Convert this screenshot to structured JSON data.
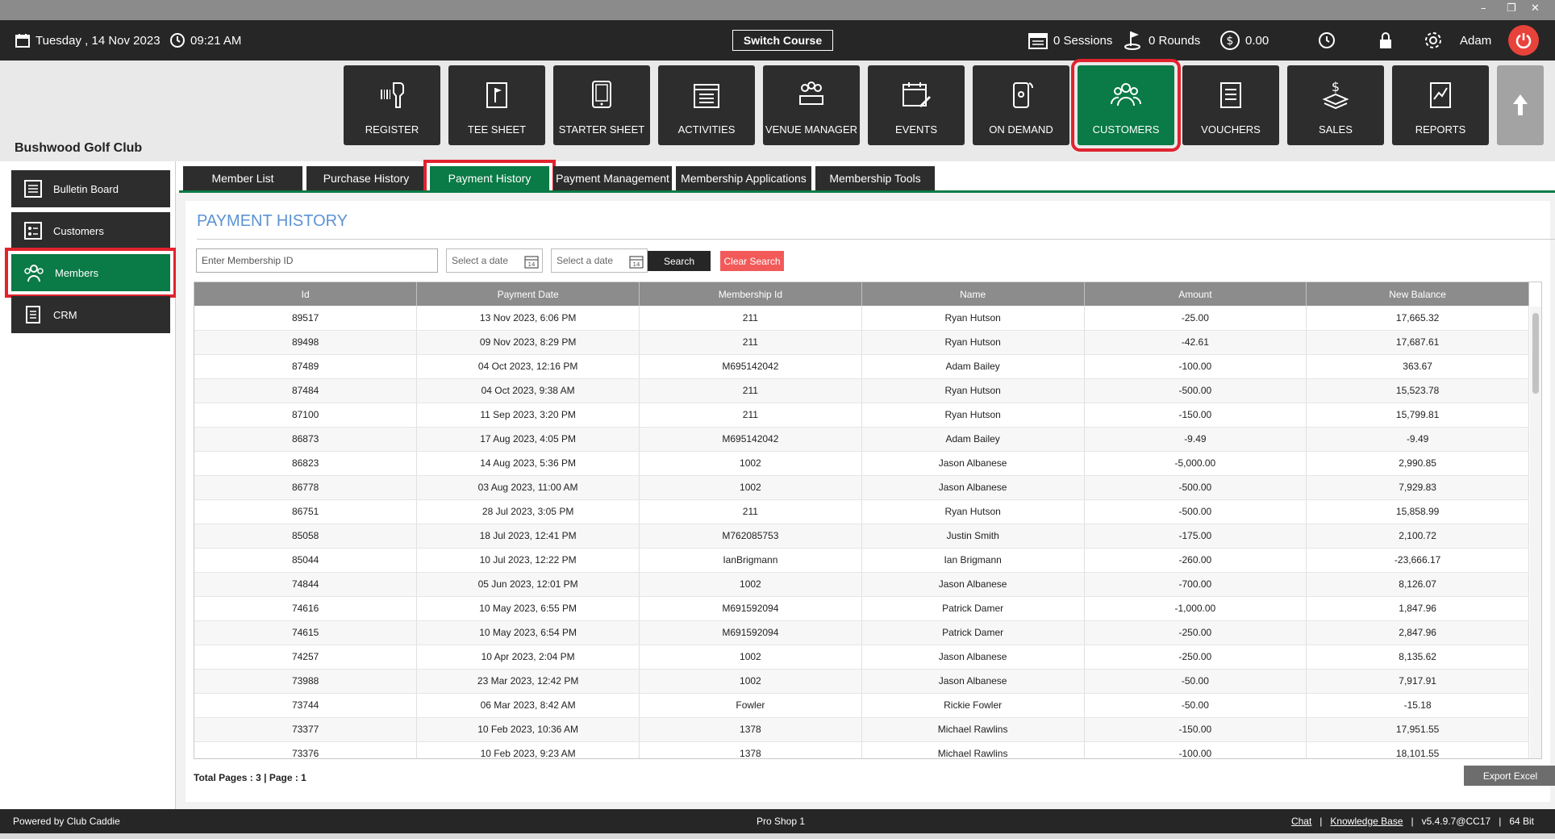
{
  "window": {
    "minimize": "–",
    "restore": "❐",
    "close": "✕"
  },
  "topbar": {
    "date": "Tuesday ,  14 Nov 2023",
    "time": "09:21 AM",
    "switch_course": "Switch Course",
    "sessions": "0 Sessions",
    "rounds": "0 Rounds",
    "balance": "0.00",
    "user": "Adam"
  },
  "club_name": "Bushwood Golf Club",
  "nav": [
    {
      "label": "REGISTER",
      "icon": "barcode-scanner-icon"
    },
    {
      "label": "TEE SHEET",
      "icon": "tee-sheet-icon"
    },
    {
      "label": "STARTER SHEET",
      "icon": "tablet-icon"
    },
    {
      "label": "ACTIVITIES",
      "icon": "activities-calendar-icon"
    },
    {
      "label": "VENUE MANAGER",
      "icon": "venue-manager-icon"
    },
    {
      "label": "EVENTS",
      "icon": "events-calendar-icon"
    },
    {
      "label": "ON DEMAND",
      "icon": "on-demand-phone-icon"
    },
    {
      "label": "CUSTOMERS",
      "icon": "customers-group-icon"
    },
    {
      "label": "VOUCHERS",
      "icon": "vouchers-icon"
    },
    {
      "label": "SALES",
      "icon": "sales-icon"
    },
    {
      "label": "REPORTS",
      "icon": "reports-icon"
    }
  ],
  "sidebar": [
    {
      "label": "Bulletin Board",
      "icon": "bulletin-board-icon"
    },
    {
      "label": "Customers",
      "icon": "customers-list-icon"
    },
    {
      "label": "Members",
      "icon": "members-icon"
    },
    {
      "label": "CRM",
      "icon": "crm-icon"
    }
  ],
  "tabs": [
    "Member List",
    "Purchase History",
    "Payment History",
    "Payment Management",
    "Membership Applications",
    "Membership Tools"
  ],
  "page_title": "PAYMENT HISTORY",
  "search": {
    "membership_placeholder": "Enter Membership ID",
    "date_from": "Select a date",
    "date_to": "Select a date",
    "search_label": "Search",
    "clear_label": "Clear Search"
  },
  "table": {
    "columns": [
      "Id",
      "Payment Date",
      "Membership Id",
      "Name",
      "Amount",
      "New Balance"
    ],
    "rows": [
      [
        "89517",
        "13 Nov 2023, 6:06 PM",
        "211",
        "Ryan  Hutson",
        "-25.00",
        "17,665.32"
      ],
      [
        "89498",
        "09 Nov 2023, 8:29 PM",
        "211",
        "Ryan  Hutson",
        "-42.61",
        "17,687.61"
      ],
      [
        "87489",
        "04 Oct 2023, 12:16 PM",
        "M695142042",
        "Adam  Bailey",
        "-100.00",
        "363.67"
      ],
      [
        "87484",
        "04 Oct 2023, 9:38 AM",
        "211",
        "Ryan  Hutson",
        "-500.00",
        "15,523.78"
      ],
      [
        "87100",
        "11 Sep 2023, 3:20 PM",
        "211",
        "Ryan  Hutson",
        "-150.00",
        "15,799.81"
      ],
      [
        "86873",
        "17 Aug 2023, 4:05 PM",
        "M695142042",
        "Adam  Bailey",
        "-9.49",
        "-9.49"
      ],
      [
        "86823",
        "14 Aug 2023, 5:36 PM",
        "1002",
        "Jason  Albanese",
        "-5,000.00",
        "2,990.85"
      ],
      [
        "86778",
        "03 Aug 2023, 11:00 AM",
        "1002",
        "Jason  Albanese",
        "-500.00",
        "7,929.83"
      ],
      [
        "86751",
        "28 Jul 2023, 3:05 PM",
        "211",
        "Ryan  Hutson",
        "-500.00",
        "15,858.99"
      ],
      [
        "85058",
        "18 Jul 2023, 12:41 PM",
        "M762085753",
        "Justin  Smith",
        "-175.00",
        "2,100.72"
      ],
      [
        "85044",
        "10 Jul 2023, 12:22 PM",
        "IanBrigmann",
        "Ian  Brigmann",
        "-260.00",
        "-23,666.17"
      ],
      [
        "74844",
        "05 Jun 2023, 12:01 PM",
        "1002",
        "Jason  Albanese",
        "-700.00",
        "8,126.07"
      ],
      [
        "74616",
        "10 May 2023, 6:55 PM",
        "M691592094",
        "Patrick  Damer",
        "-1,000.00",
        "1,847.96"
      ],
      [
        "74615",
        "10 May 2023, 6:54 PM",
        "M691592094",
        "Patrick  Damer",
        "-250.00",
        "2,847.96"
      ],
      [
        "74257",
        "10 Apr 2023, 2:04 PM",
        "1002",
        "Jason  Albanese",
        "-250.00",
        "8,135.62"
      ],
      [
        "73988",
        "23 Mar 2023, 12:42 PM",
        "1002",
        "Jason  Albanese",
        "-50.00",
        "7,917.91"
      ],
      [
        "73744",
        "06 Mar 2023, 8:42 AM",
        "Fowler",
        "Rickie  Fowler",
        "-50.00",
        "-15.18"
      ],
      [
        "73377",
        "10 Feb 2023, 10:36 AM",
        "1378",
        "Michael  Rawlins",
        "-150.00",
        "17,951.55"
      ],
      [
        "73376",
        "10 Feb 2023, 9:23 AM",
        "1378",
        "Michael  Rawlins",
        "-100.00",
        "18,101.55"
      ]
    ]
  },
  "total_pages": "Total Pages : 3 | Page : 1",
  "export_label": "Export Excel",
  "footer": {
    "powered": "Powered by Club Caddie",
    "location": "Pro Shop 1",
    "chat": "Chat",
    "knowledge_base": "Knowledge Base",
    "version": "v5.4.9.7@CC17",
    "bits": "64 Bit"
  },
  "colors": {
    "accent_green": "#0a7a46",
    "highlight_red": "#e0232e",
    "title_blue": "#5b93d3",
    "dark": "#2d2d2d"
  }
}
